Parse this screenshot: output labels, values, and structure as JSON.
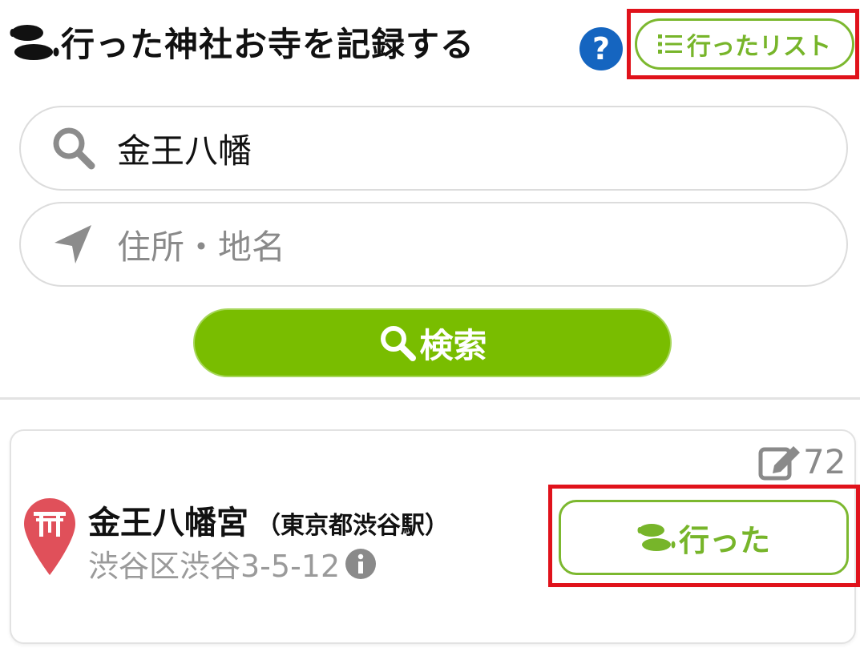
{
  "header": {
    "title": "行った神社お寺を記録する",
    "title_icon": "footprints-icon",
    "help_label": "?",
    "help_icon": "help-icon",
    "list_button_label": "行ったリスト",
    "list_icon": "list-icon"
  },
  "search": {
    "query_value": "金王八幡",
    "query_icon": "search-icon",
    "place_placeholder": "住所・地名",
    "place_icon": "location-arrow-icon",
    "submit_label": "検索",
    "submit_icon": "search-icon"
  },
  "result": {
    "comment_count": "72",
    "comment_icon": "edit-icon",
    "pin_icon": "shrine-pin-icon",
    "name": "金王八幡宮",
    "station": "（東京都渋谷駅）",
    "address": "渋谷区渋谷3-5-12",
    "info_icon": "info-icon",
    "went_label": "行った",
    "went_icon": "footprints-icon"
  },
  "colors": {
    "accent_green": "#79bd00",
    "outline_green": "#7cb82f",
    "help_blue": "#1565c0",
    "highlight_red": "#e0121b",
    "pin_red": "#e0505a",
    "muted_gray": "#9a9a9a"
  }
}
